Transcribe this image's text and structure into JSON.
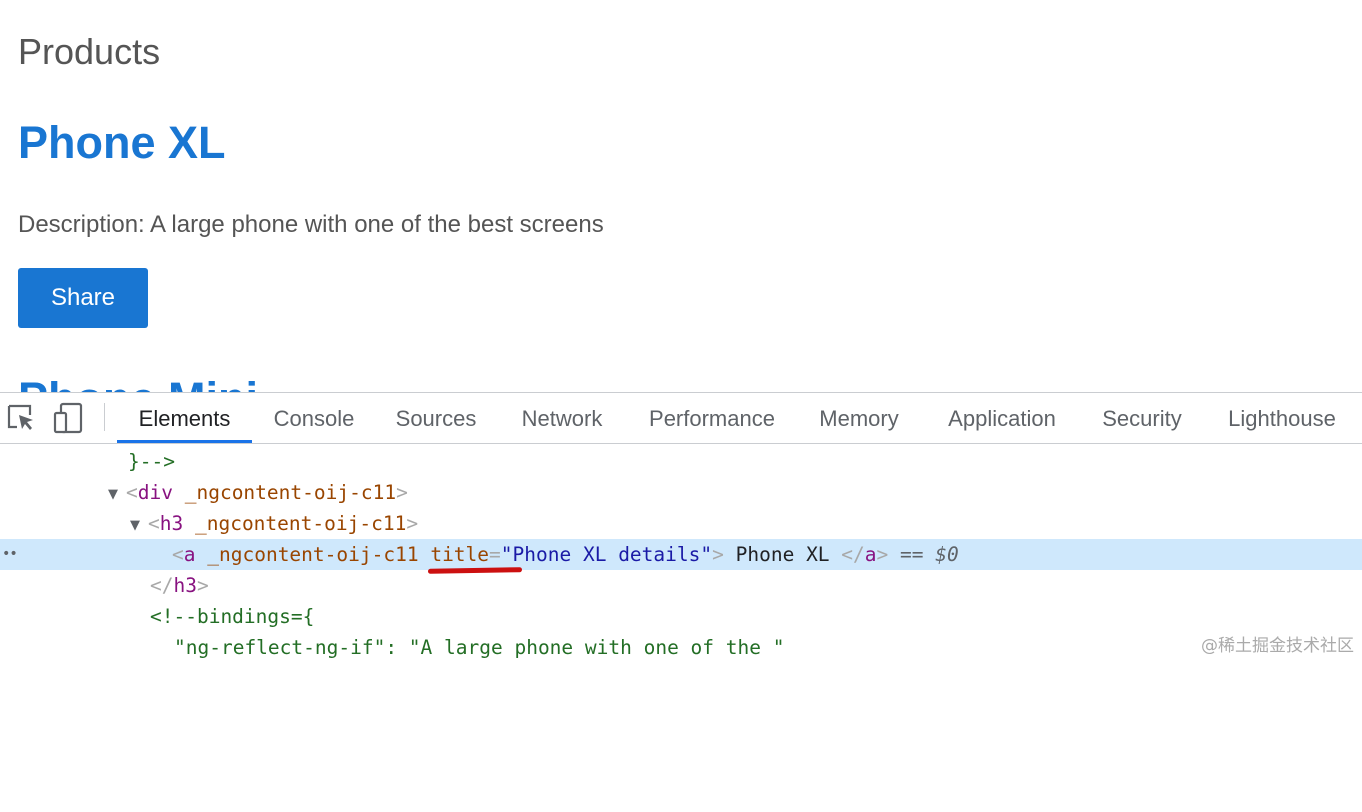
{
  "page": {
    "title": "Products",
    "product_name": "Phone XL",
    "description": "Description: A large phone with one of the best screens",
    "share_label": "Share",
    "next_product_name": "Phone Mini"
  },
  "devtools": {
    "icons": [
      "inspect-element-icon",
      "device-toolbar-icon"
    ],
    "tabs": [
      {
        "label": "Elements",
        "active": true
      },
      {
        "label": "Console"
      },
      {
        "label": "Sources"
      },
      {
        "label": "Network"
      },
      {
        "label": "Performance"
      },
      {
        "label": "Memory"
      },
      {
        "label": "Application"
      },
      {
        "label": "Security"
      },
      {
        "label": "Lighthouse"
      }
    ],
    "tree": {
      "line1": "}-->",
      "line2_tag": "div",
      "line2_attr": "_ngcontent-oij-c11",
      "line3_tag": "h3",
      "line3_attr": "_ngcontent-oij-c11",
      "line4_tag": "a",
      "line4_attr1": "_ngcontent-oij-c11",
      "line4_attr2": "title",
      "line4_val": "Phone XL details",
      "line4_text": "Phone XL",
      "line4_eq": "== $0",
      "line5_tag": "h3",
      "line6": "<!--bindings={",
      "line7": "\"ng-reflect-ng-if\": \"A large phone with one of the \""
    }
  },
  "watermark": "@稀土掘金技术社区",
  "colors": {
    "accent": "#1976d2",
    "selection": "#cfe8fc",
    "active_tab": "#1a73e8"
  }
}
